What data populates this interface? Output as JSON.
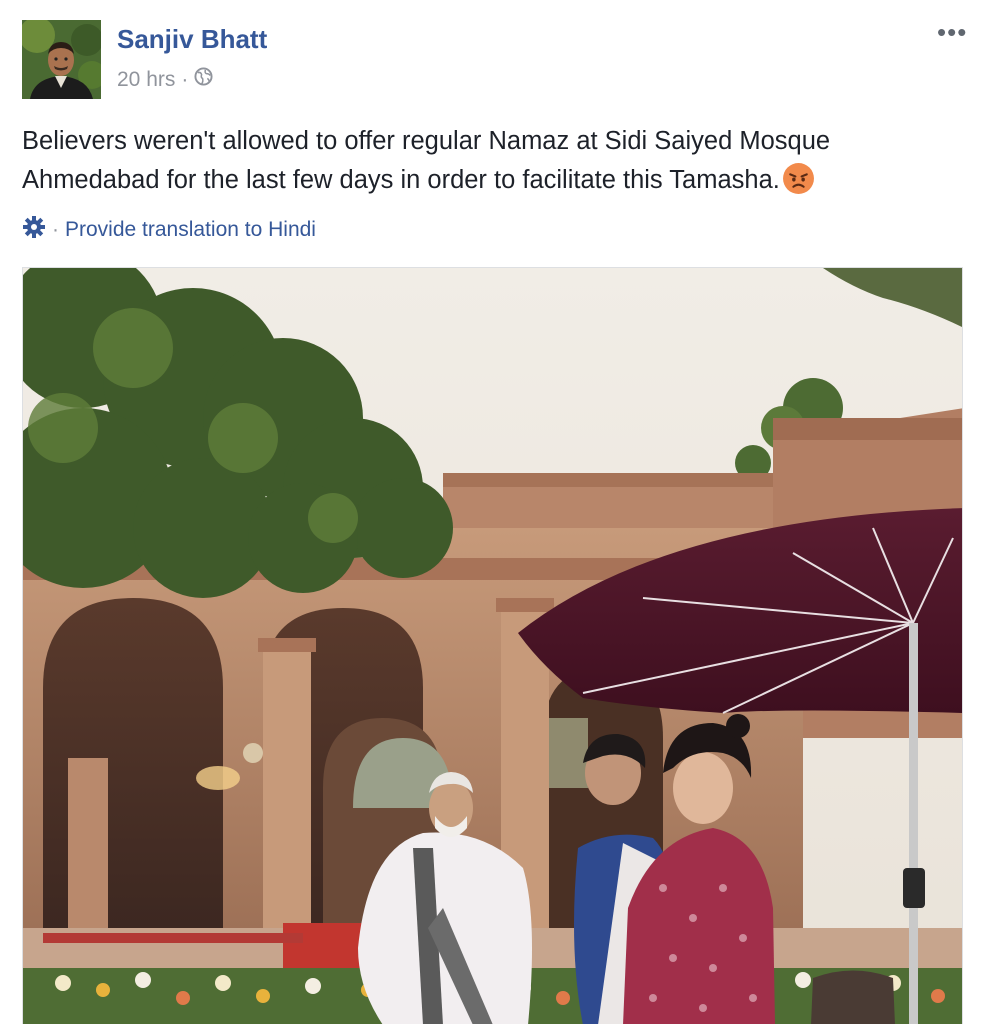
{
  "post": {
    "author": "Sanjiv Bhatt",
    "timestamp": "20 hrs",
    "separator": "·",
    "privacy_icon": "globe-icon",
    "more_label": "•••",
    "text": "Believers weren't allowed to offer regular Namaz at Sidi Saiyed Mosque Ahmedabad for the last few days in order to facilitate this Tamasha.",
    "emoji_icon": "angry-face-icon",
    "translation": {
      "icon": "gear-icon",
      "separator": "·",
      "link_label": "Provide translation to Hindi"
    }
  },
  "colors": {
    "author_link": "#365899",
    "meta_text": "#90949c",
    "body_text": "#1d2129"
  }
}
